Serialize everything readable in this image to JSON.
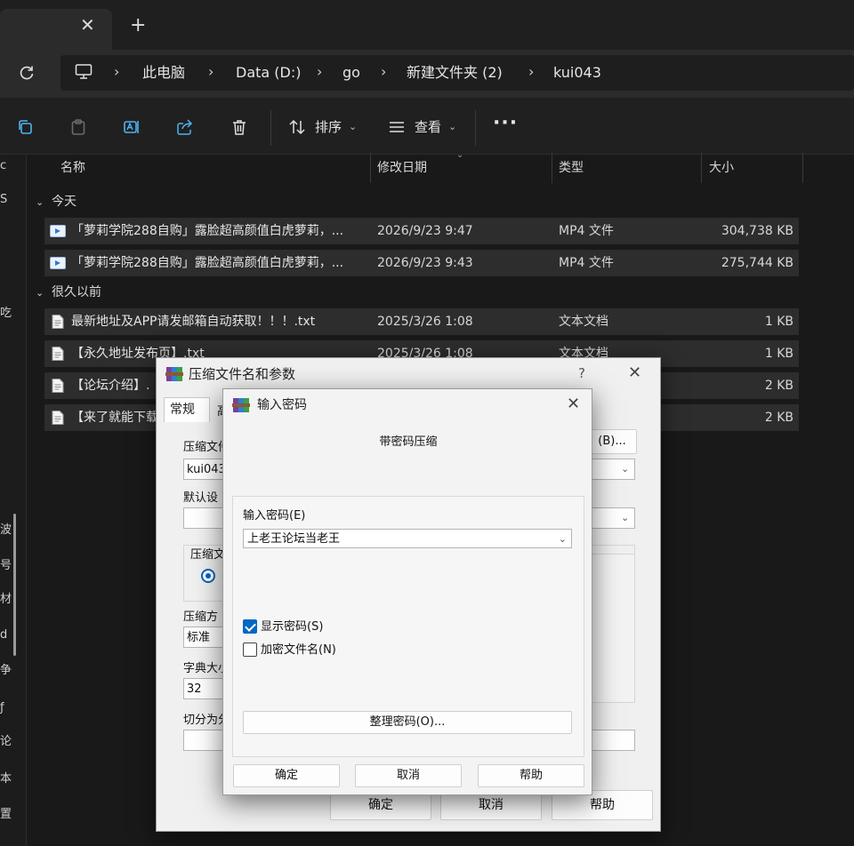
{
  "tabs": {
    "close": "✕",
    "new": "+"
  },
  "breadcrumb": {
    "items": [
      "此电脑",
      "Data (D:)",
      "go",
      "新建文件夹 (2)",
      "kui043"
    ],
    "separator": "›"
  },
  "toolbar": {
    "sort_label": "排序",
    "view_label": "查看",
    "more": "···",
    "caret": "⌄"
  },
  "columns": {
    "name": "名称",
    "modified": "修改日期",
    "type": "类型",
    "size": "大小"
  },
  "groups": [
    {
      "label": "今天",
      "files": [
        {
          "name": "「萝莉学院288自购」露脸超高颜值白虎萝莉，...",
          "modified": "2026/9/23 9:47",
          "type": "MP4 文件",
          "size": "304,738 KB",
          "icon": "video-file-icon"
        },
        {
          "name": "「萝莉学院288自购」露脸超高颜值白虎萝莉，...",
          "modified": "2026/9/23 9:43",
          "type": "MP4 文件",
          "size": "275,744 KB",
          "icon": "video-file-icon"
        }
      ]
    },
    {
      "label": "很久以前",
      "files": [
        {
          "name": "最新地址及APP请发邮箱自动获取！！！.txt",
          "modified": "2025/3/26 1:08",
          "type": "文本文档",
          "size": "1 KB",
          "icon": "text-file-icon"
        },
        {
          "name": "【永久地址发布页】.txt",
          "modified": "2025/3/26 1:08",
          "type": "文本文档",
          "size": "1 KB",
          "icon": "text-file-icon"
        },
        {
          "name": "【论坛介绍】.",
          "modified": "",
          "type": "",
          "size": "2 KB",
          "icon": "text-file-icon"
        },
        {
          "name": "【来了就能下载",
          "modified": "",
          "type": "",
          "size": "2 KB",
          "icon": "text-file-icon"
        }
      ]
    }
  ],
  "left_pane_glyphs": [
    "c",
    "S",
    "吃",
    "波",
    "号",
    "材",
    "d",
    "争",
    "ƒ",
    "论",
    "本",
    "置"
  ],
  "archive_dialog": {
    "title": "压缩文件名和参数",
    "help": "?",
    "close": "✕",
    "tab_general": "常规",
    "tab_second": "高",
    "archive_name_label": "压缩文件",
    "archive_name_value": "kui043",
    "browse_button": "(B)...",
    "default_label": "默认设",
    "group_label": "压缩文",
    "method_label": "压缩方",
    "method_value": "标准",
    "dict_label": "字典大小",
    "dict_value": "32",
    "split_label": "切分为分",
    "ok": "确定",
    "cancel": "取消",
    "help_button": "帮助"
  },
  "password_dialog": {
    "title": "输入密码",
    "close": "✕",
    "heading": "带密码压缩",
    "label": "输入密码(E)",
    "password": "上老王论坛当老王",
    "show_password": {
      "label": "显示密码(S)",
      "checked": true
    },
    "encrypt_names": {
      "label": "加密文件名(N)",
      "checked": false
    },
    "organize": "整理密码(O)...",
    "ok": "确定",
    "cancel": "取消",
    "help": "帮助"
  }
}
